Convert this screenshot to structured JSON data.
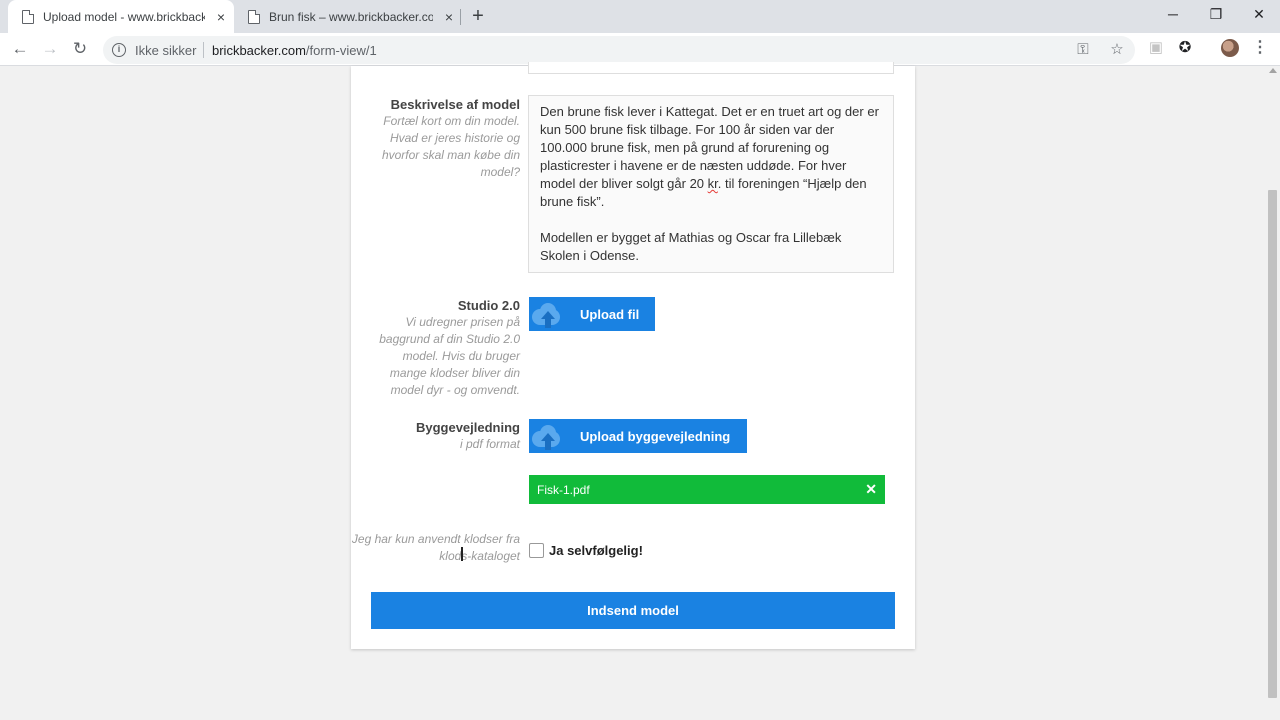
{
  "browser": {
    "tabs": [
      {
        "title": "Upload model - www.brickbacker.com",
        "active": true
      },
      {
        "title": "Brun fisk – www.brickbacker.com",
        "active": false
      }
    ],
    "tab_close": "×",
    "new_tab": "+",
    "window_controls": {
      "minimize": "─",
      "restore": "❐",
      "close": "✕"
    },
    "nav": {
      "back": "←",
      "forward": "→",
      "reload": "↻"
    },
    "security_label": "Ikke sikker",
    "url_host": "brickbacker.com",
    "url_path": "/form-view/1",
    "icons": {
      "key": "⚿",
      "star": "☆",
      "ext1": "▣",
      "ext2": "✪",
      "menu": "⋮"
    }
  },
  "form": {
    "description": {
      "label": "Beskrivelse af model",
      "hint": "Fortæl kort om din model. Hvad er jeres historie og hvorfor skal man købe din model?",
      "value_p1_a": "Den brune fisk lever i Kattegat. Det er en truet art og der er kun 500 brune fisk tilbage. For 100 år siden var der 100.000 brune fisk, men på grund af forurening og plasticrester i havene er de næsten uddøde. For hver model der bliver solgt går 20 ",
      "value_p1_kr": "kr",
      "value_p1_b": ". til foreningen “Hjælp den brune fisk”.",
      "value_p2": "Modellen er bygget af Mathias og Oscar fra Lillebæk Skolen i Odense."
    },
    "studio": {
      "label": "Studio 2.0",
      "hint": "Vi udregner prisen på baggrund af din Studio 2.0 model. Hvis du bruger mange klodser bliver din model dyr - og omvendt.",
      "button": "Upload fil"
    },
    "instructions": {
      "label": "Byggevejledning",
      "hint": "i pdf format",
      "button": "Upload byggevejledning",
      "uploaded_file": "Fisk-1.pdf",
      "remove": "✕"
    },
    "bricks_confirm": {
      "hint": "Jeg har kun anvendt klodser fra klods-kataloget",
      "checkbox_label": "Ja selvfølgelig!",
      "checked": false
    },
    "submit": "Indsend model"
  }
}
